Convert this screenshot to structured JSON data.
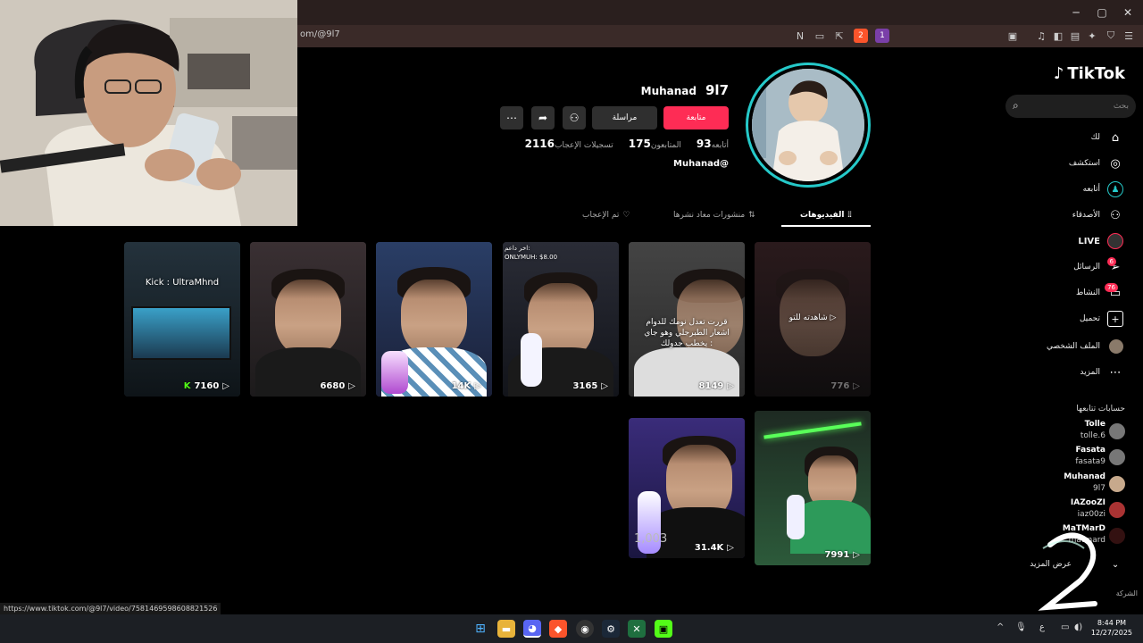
{
  "browser": {
    "url": "om/@9l7",
    "status_url": "https://www.tiktok.com/@9l7/video/7581469598608821526",
    "minimize": "─",
    "maximize": "▢",
    "close": "✕",
    "brave_badge": "2",
    "alert_badge": "1"
  },
  "tiktok": {
    "logo": "TikTok",
    "search_placeholder": "بحث",
    "nav": [
      {
        "label": "لك",
        "icon": "home-icon"
      },
      {
        "label": "استكشف",
        "icon": "compass-icon"
      },
      {
        "label": "أتابعه",
        "icon": "following-icon"
      },
      {
        "label": "الأصدقاء",
        "icon": "friends-icon"
      },
      {
        "label": "LIVE",
        "icon": "live-icon"
      },
      {
        "label": "الرسائل",
        "icon": "messages-icon",
        "badge": "6"
      },
      {
        "label": "النشاط",
        "icon": "activity-icon",
        "badge": "76"
      },
      {
        "label": "تحميل",
        "icon": "upload-icon"
      },
      {
        "label": "الملف الشخصي",
        "icon": "profile-icon"
      },
      {
        "label": "المزيد",
        "icon": "more-icon"
      }
    ],
    "following_title": "حسابات تتابعها",
    "following": [
      {
        "name": "Tolle",
        "handle": "tolle.6"
      },
      {
        "name": "Fasata",
        "handle": "fasata9"
      },
      {
        "name": "Muhanad",
        "handle": "9l7"
      },
      {
        "name": "IAZooZI",
        "handle": "iaz00zi"
      },
      {
        "name": "MaTMarD",
        "handle": "matmard"
      }
    ],
    "see_more": "عرض المزيد",
    "company": "الشركة"
  },
  "profile": {
    "uid": "9l7",
    "display_name": "Muhanad",
    "handle": "Muhanad@",
    "follow_label": "متابعة",
    "message_label": "مراسلة",
    "stats": [
      {
        "num": "93",
        "label": "أتابعه"
      },
      {
        "num": "175",
        "label": "المتابعون"
      },
      {
        "num": "2116",
        "label": "تسجيلات الإعجاب"
      }
    ],
    "tabs": [
      {
        "label": "الفيديوهات",
        "icon": "grid-icon"
      },
      {
        "label": "منشورات معاد نشرها",
        "icon": "repost-icon"
      },
      {
        "label": "تم الإعجاب",
        "icon": "liked-icon"
      }
    ]
  },
  "videos": [
    {
      "views": "776",
      "overlay": "شاهدته للتو ▷"
    },
    {
      "views": "8149",
      "overlay": "قررت تعدل نومك للدوام\nاشعار الطبرجلي وهو جاي\nيخطب جدولك :"
    },
    {
      "views": "3165",
      "overlay": "اخر داعم:\nONLYMUH: $8.00"
    },
    {
      "views": "14K",
      "overlay": ""
    },
    {
      "views": "6680",
      "overlay": ""
    },
    {
      "views": "7160",
      "overlay": "Kick : UltraMhnd"
    },
    {
      "views": "7991",
      "overlay": ""
    },
    {
      "views": "31.4K",
      "overlay": "1,003"
    }
  ],
  "taskbar": {
    "time": "8:44 PM",
    "date": "12/27/2025",
    "lang": "ع"
  }
}
